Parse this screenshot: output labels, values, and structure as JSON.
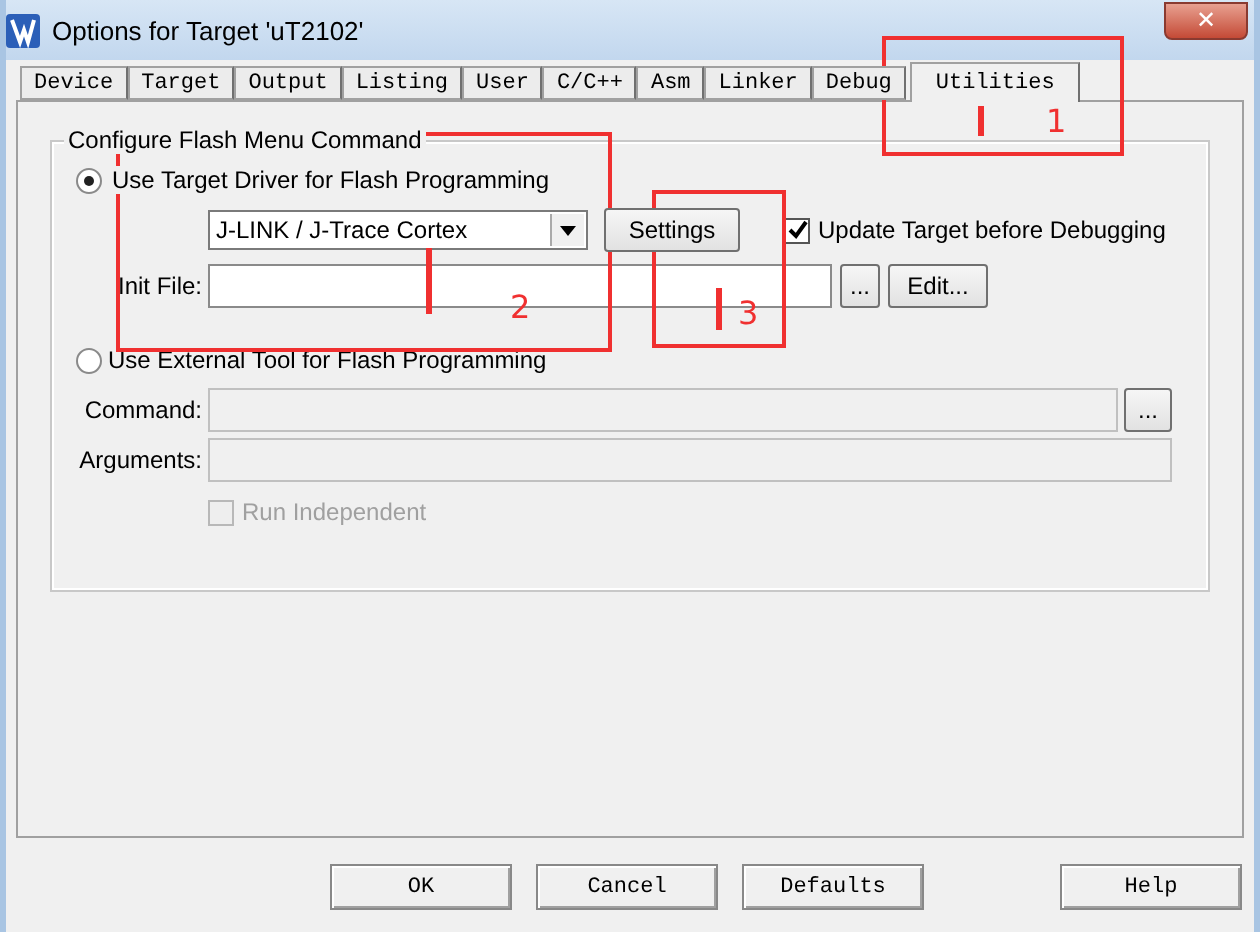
{
  "window": {
    "title": "Options for Target 'uT2102'",
    "close": "✕"
  },
  "tabs": [
    {
      "label": "Device",
      "selected": false
    },
    {
      "label": "Target",
      "selected": false
    },
    {
      "label": "Output",
      "selected": false
    },
    {
      "label": "Listing",
      "selected": false
    },
    {
      "label": "User",
      "selected": false
    },
    {
      "label": "C/C++",
      "selected": false
    },
    {
      "label": "Asm",
      "selected": false
    },
    {
      "label": "Linker",
      "selected": false
    },
    {
      "label": "Debug",
      "selected": false
    },
    {
      "label": "Utilities",
      "selected": true
    }
  ],
  "group": {
    "title": "Configure Flash Menu Command",
    "options": [
      {
        "label": "Use Target Driver for Flash Programming",
        "selected": true
      },
      {
        "label": "Use External Tool for Flash Programming",
        "selected": false
      }
    ],
    "driver": {
      "value": "J-LINK / J-Trace Cortex"
    },
    "settings_button": "Settings",
    "update_target": {
      "label": "Update Target before Debugging",
      "checked": true
    },
    "init_file": {
      "label": "Init File:",
      "browse": "...",
      "edit": "Edit..."
    },
    "command": {
      "label": "Command:",
      "browse": "..."
    },
    "arguments": {
      "label": "Arguments:"
    },
    "run_independent": {
      "label": "Run Independent",
      "checked": false,
      "disabled": true
    }
  },
  "buttons": [
    "OK",
    "Cancel",
    "Defaults",
    "Help"
  ],
  "annotations": [
    {
      "number": "1"
    },
    {
      "number": "2"
    },
    {
      "number": "3"
    }
  ]
}
